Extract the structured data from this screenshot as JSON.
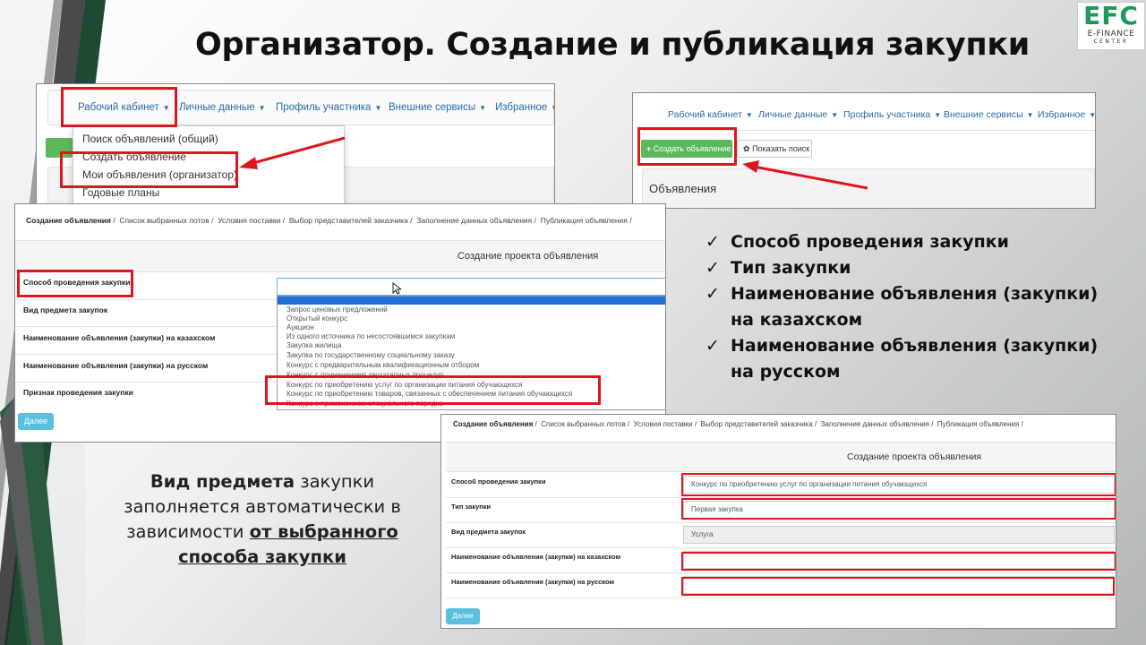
{
  "slide": {
    "title": "Организатор. Создание и публикация закупки"
  },
  "logo": {
    "big": "EFC",
    "line1": "E-FINANCE",
    "line2": "CENTER"
  },
  "nav": {
    "cabinet": "Рабочий кабинет",
    "personal": "Личные данные",
    "profile": "Профиль участника",
    "external": "Внешние сервисы",
    "favorites": "Избранное"
  },
  "dropdown": {
    "items": [
      "Поиск объявлений (общий)",
      "Создать объявление",
      "Мои объявления (организатор)",
      "Годовые планы"
    ]
  },
  "panel2": {
    "create_button": "Создать объявление",
    "show_search_button": "Показать поиск",
    "section_title": "Объявления"
  },
  "form": {
    "breadcrumbs": [
      "Создание объявления",
      "Список выбранных лотов",
      "Условия поставки",
      "Выбор представителей заказчика",
      "Заполнение данных объявления",
      "Публикация объявления"
    ],
    "heading": "Создание проекта объявления",
    "labels": {
      "method": "Способ проведения закупки",
      "subject": "Вид предмета закупок",
      "name_kz": "Наименование объявления (закупки) на казахском",
      "name_ru": "Наименование объявления (закупки) на русском",
      "sign": "Признак проведения закупки",
      "type": "Тип закупки"
    },
    "method_options": [
      "Запрос ценовых предложений",
      "Открытый конкурс",
      "Аукцион",
      "Из одного источника по несостоявшимся закупкам",
      "Закупка жилища",
      "Закупка по государственному социальному заказу",
      "Конкурс с предварительным квалификационным отбором",
      "Конкурс с применением двухэтапных процедур",
      "Конкурс по приобретению услуг по организации питания обучающихся",
      "Конкурс по приобретению товаров, связанных с обеспечением питания обучающихся",
      "Конкурс с применением специального порядка"
    ],
    "next_button": "Далее",
    "values": {
      "method": "Конкурс по приобретению услуг по организации питания обучающихся",
      "type": "Первая закупка",
      "subject": "Услуга"
    }
  },
  "checklist": {
    "mark": "✓",
    "items": [
      "Способ проведения закупки",
      "Тип закупки",
      "Наименование объявления (закупки) на казахском",
      "Наименование объявления (закупки) на русском"
    ]
  },
  "note": {
    "bold_start": "Вид предмета",
    "middle": " закупки заполняется автоматически в зависимости ",
    "underlined": "от выбранного способа закупки"
  },
  "colors": {
    "highlight": "#e0141c",
    "link": "#2a6aa8",
    "green": "#5cb85c",
    "info": "#5bc0de",
    "band_dark": "#1a4a32",
    "band_gray": "#555555"
  }
}
